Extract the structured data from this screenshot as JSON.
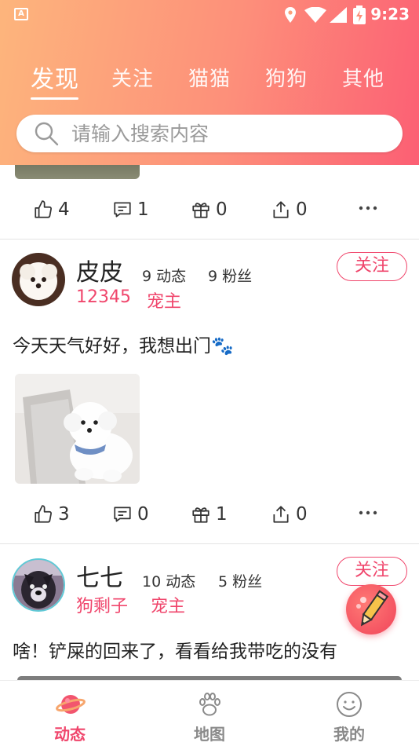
{
  "status_bar": {
    "time": "9:23",
    "app_badge": "A"
  },
  "tabs": [
    {
      "label": "发现",
      "active": true
    },
    {
      "label": "关注",
      "active": false
    },
    {
      "label": "猫猫",
      "active": false
    },
    {
      "label": "狗狗",
      "active": false
    },
    {
      "label": "其他",
      "active": false
    }
  ],
  "search": {
    "placeholder": "请输入搜索内容",
    "value": ""
  },
  "posts": [
    {
      "actions": {
        "likes": "4",
        "comments": "1",
        "gifts": "0",
        "shares": "0"
      }
    },
    {
      "user_name": "皮皮",
      "posts_count": "9",
      "posts_label": "动态",
      "fans_count": "9",
      "fans_label": "粉丝",
      "tag1": "12345",
      "tag2": "宠主",
      "follow_label": "关注",
      "text": "今天天气好好，我想出门🐾",
      "actions": {
        "likes": "3",
        "comments": "0",
        "gifts": "1",
        "shares": "0"
      }
    },
    {
      "user_name": "七七",
      "posts_count": "10",
      "posts_label": "动态",
      "fans_count": "5",
      "fans_label": "粉丝",
      "tag1": "狗剩子",
      "tag2": "宠主",
      "follow_label": "关注",
      "text": "啥！铲屎的回来了，看看给我带吃的没有"
    }
  ],
  "icons": {
    "like": "thumbs-up-icon",
    "comment": "comment-icon",
    "gift": "gift-icon",
    "share": "share-icon",
    "more": "more-dots-icon",
    "fab": "edit-pencil-icon"
  },
  "bottom_nav": [
    {
      "label": "动态",
      "icon": "planet-icon",
      "active": true
    },
    {
      "label": "地图",
      "icon": "paw-icon",
      "active": false
    },
    {
      "label": "我的",
      "icon": "smiley-icon",
      "active": false
    }
  ],
  "colors": {
    "accent": "#f0466c",
    "header_start": "#fdb57c",
    "header_end": "#fc5f74"
  }
}
